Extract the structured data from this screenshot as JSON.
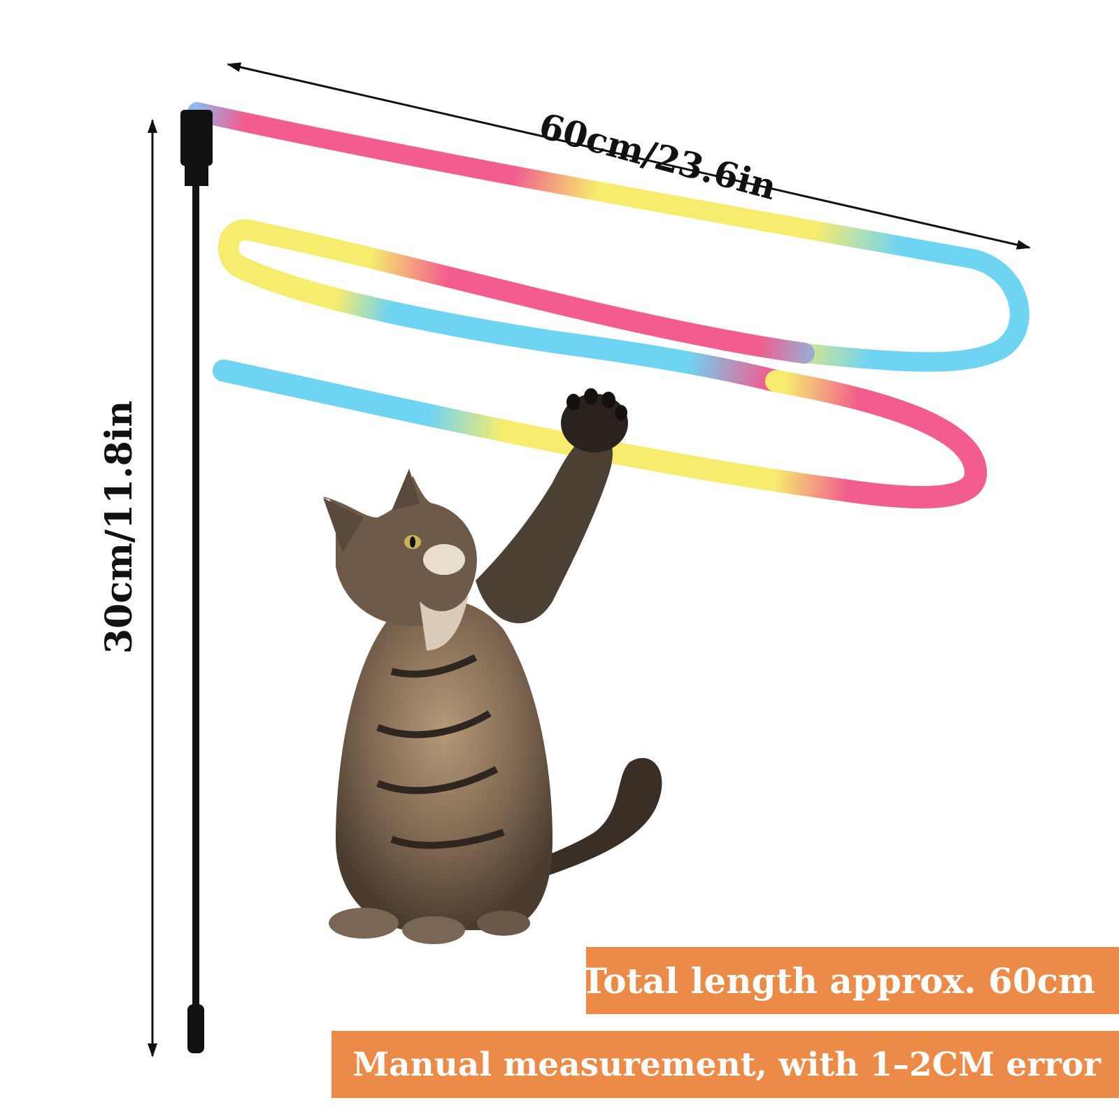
{
  "dimensions": {
    "ribbon_length_label": "60cm/23.6in",
    "wand_length_label": "30cm/11.8in"
  },
  "banners": [
    {
      "text": "Total length approx. 60cm"
    },
    {
      "text": "Manual measurement, with 1–2CM error"
    }
  ],
  "colors": {
    "banner": "#ec8b47",
    "ribbon_pink": "#f25c8e",
    "ribbon_yellow": "#f6ec6e",
    "ribbon_blue": "#6fd3f2",
    "wand": "#111111"
  },
  "icons": {
    "product_photo": "cat-playing-with-rainbow-ribbon-wand"
  }
}
